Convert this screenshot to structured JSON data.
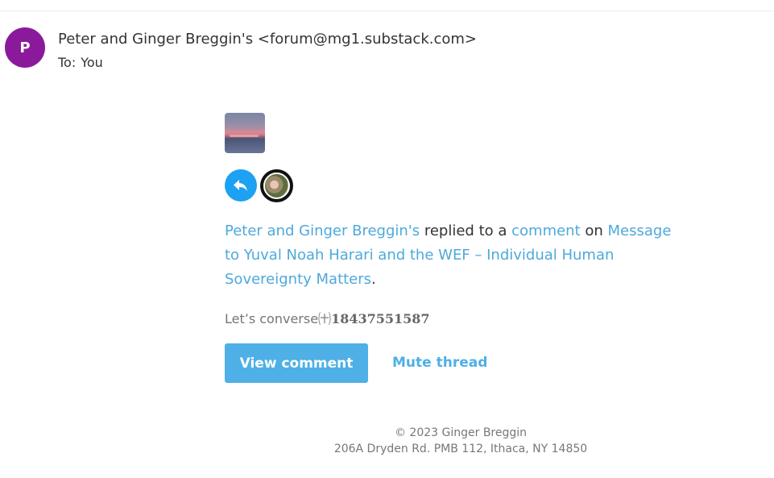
{
  "header": {
    "avatar_letter": "P",
    "avatar_color": "#8a1a9b",
    "sender": "Peter and Ginger Breggin's <forum@mg1.substack.com>",
    "to_label": "To:",
    "to_value": "You"
  },
  "body": {
    "message": {
      "actor": "Peter and Ginger Breggin's",
      "text1": " replied to a ",
      "comment_link": "comment",
      "text2": " on ",
      "post_link": "Message to Yuval Noah Harari and the WEF – Individual Human Sovereignty Matters",
      "end": "."
    },
    "line_text": "Let’s converse㈩",
    "line_phone": "18437551587",
    "view_button": "View comment",
    "mute_button": "Mute thread"
  },
  "footer": {
    "copyright": "© 2023 Ginger Breggin",
    "address": "206A Dryden Rd. PMB 112, Ithaca, NY 14850"
  },
  "colors": {
    "link": "#4ea9dc",
    "button": "#4eb0e6",
    "reply_badge": "#1da1f2"
  },
  "icons": {
    "reply_badge": "reply-arrow-icon"
  }
}
